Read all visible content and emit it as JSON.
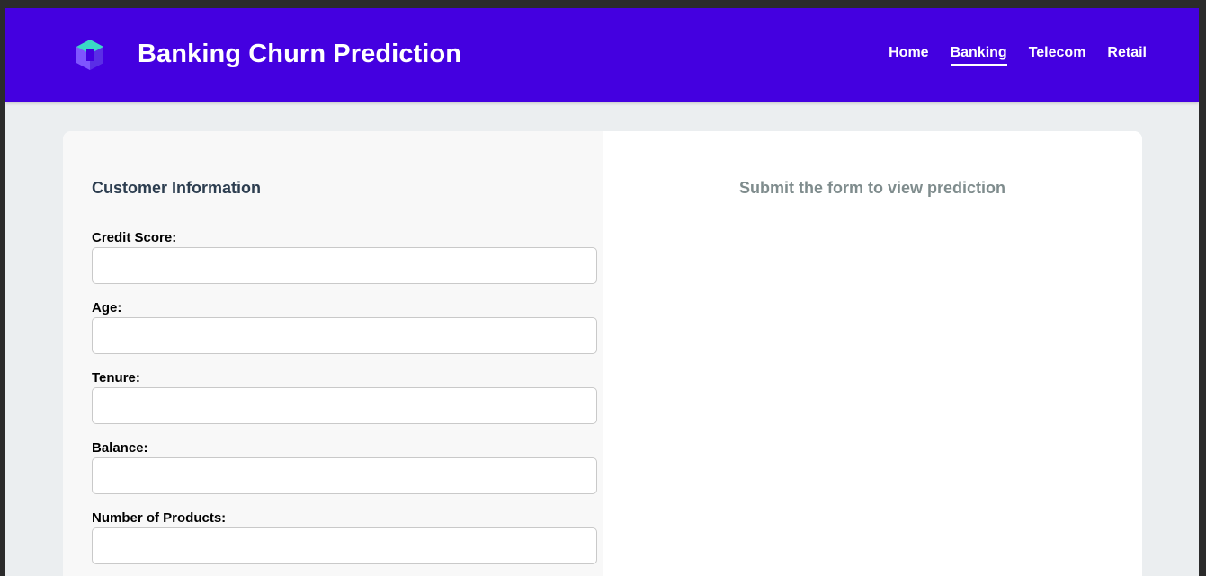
{
  "header": {
    "title": "Banking Churn Prediction",
    "logo_icon": "cube-logo-icon",
    "nav": [
      {
        "label": "Home",
        "active": false
      },
      {
        "label": "Banking",
        "active": true
      },
      {
        "label": "Telecom",
        "active": false
      },
      {
        "label": "Retail",
        "active": false
      }
    ]
  },
  "form": {
    "section_title": "Customer Information",
    "fields": [
      {
        "label": "Credit Score:",
        "value": "",
        "placeholder": ""
      },
      {
        "label": "Age:",
        "value": "",
        "placeholder": ""
      },
      {
        "label": "Tenure:",
        "value": "",
        "placeholder": ""
      },
      {
        "label": "Balance:",
        "value": "",
        "placeholder": ""
      },
      {
        "label": "Number of Products:",
        "value": "",
        "placeholder": ""
      }
    ]
  },
  "result": {
    "placeholder": "Submit the form to view prediction"
  },
  "colors": {
    "header_bg": "#4400e0",
    "page_bg": "#ebeef0",
    "logo_teal": "#2fe0c4",
    "logo_purple": "#7b4dff"
  }
}
